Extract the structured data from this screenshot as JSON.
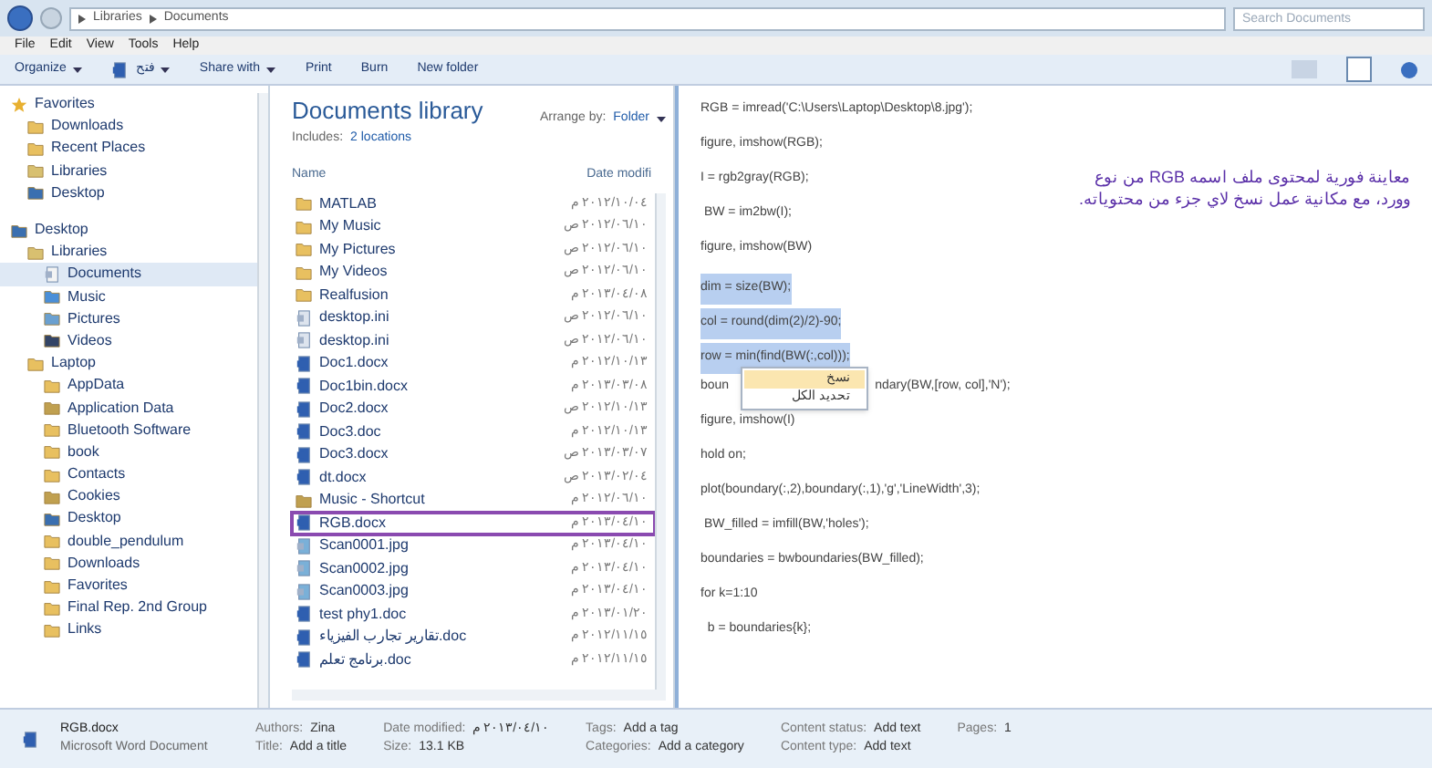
{
  "address_bar": {
    "crumbs": [
      "Libraries",
      "Documents"
    ],
    "search_placeholder": "Search Documents"
  },
  "menu_bar": [
    "File",
    "Edit",
    "View",
    "Tools",
    "Help"
  ],
  "toolbar": [
    {
      "label": "Organize",
      "dropdown": true
    },
    {
      "label": "فتح",
      "dropdown": true,
      "kind": "open"
    },
    {
      "label": "Share with",
      "dropdown": true
    },
    {
      "label": "Print",
      "dropdown": false
    },
    {
      "label": "Burn",
      "dropdown": false
    },
    {
      "label": "New folder",
      "dropdown": false
    }
  ],
  "nav_tree": [
    {
      "label": "Favorites",
      "kind": "star",
      "selected": false,
      "children": [
        {
          "label": "Downloads",
          "kind": "folder",
          "selected": false
        },
        {
          "label": "Recent Places",
          "kind": "folder",
          "selected": false
        },
        {
          "label": "Libraries",
          "kind": "library",
          "selected": false
        },
        {
          "label": "Desktop",
          "kind": "desktop",
          "selected": false
        }
      ]
    },
    {
      "label": "Desktop",
      "kind": "desktop",
      "selected": false,
      "children": [
        {
          "label": "Libraries",
          "kind": "library",
          "selected": false,
          "children": [
            {
              "label": "Documents",
              "kind": "document",
              "selected": true
            },
            {
              "label": "Music",
              "kind": "music",
              "selected": false
            },
            {
              "label": "Pictures",
              "kind": "picture",
              "selected": false
            },
            {
              "label": "Videos",
              "kind": "video",
              "selected": false
            }
          ]
        },
        {
          "label": "Laptop",
          "kind": "folder",
          "selected": false,
          "children": [
            {
              "label": "AppData",
              "kind": "folder",
              "selected": false
            },
            {
              "label": "Application Data",
              "kind": "shortcut",
              "selected": false
            },
            {
              "label": "Bluetooth Software",
              "kind": "folder",
              "selected": false
            },
            {
              "label": "book",
              "kind": "folder",
              "selected": false
            },
            {
              "label": "Contacts",
              "kind": "folder",
              "selected": false
            },
            {
              "label": "Cookies",
              "kind": "shortcut",
              "selected": false
            },
            {
              "label": "Desktop",
              "kind": "desktop",
              "selected": false
            },
            {
              "label": "double_pendulum",
              "kind": "folder",
              "selected": false
            },
            {
              "label": "Downloads",
              "kind": "folder",
              "selected": false
            },
            {
              "label": "Favorites",
              "kind": "folder",
              "selected": false
            },
            {
              "label": "Final Rep. 2nd Group",
              "kind": "folder",
              "selected": false
            },
            {
              "label": "Links",
              "kind": "folder",
              "selected": false
            }
          ]
        }
      ]
    }
  ],
  "library": {
    "title": "Documents library",
    "includes_label": "Includes:",
    "includes_link": "2 locations",
    "arrange_label": "Arrange by:",
    "arrange_value": "Folder"
  },
  "file_list": {
    "columns": [
      "Name",
      "Date modifi"
    ],
    "rows": [
      {
        "name": "MATLAB",
        "date": "٢٠١٢/١٠/٠٤ م",
        "kind": "folder",
        "selected": false
      },
      {
        "name": "My Music",
        "date": "٢٠١٢/٠٦/١٠ ص",
        "kind": "folder",
        "selected": false
      },
      {
        "name": "My Pictures",
        "date": "٢٠١٢/٠٦/١٠ ص",
        "kind": "folder",
        "selected": false
      },
      {
        "name": "My Videos",
        "date": "٢٠١٢/٠٦/١٠ ص",
        "kind": "folder",
        "selected": false
      },
      {
        "name": "Realfusion",
        "date": "٢٠١٣/٠٤/٠٨ م",
        "kind": "folder",
        "selected": false
      },
      {
        "name": "desktop.ini",
        "date": "٢٠١٢/٠٦/١٠ ص",
        "kind": "ini",
        "selected": false
      },
      {
        "name": "desktop.ini",
        "date": "٢٠١٢/٠٦/١٠ ص",
        "kind": "ini",
        "selected": false
      },
      {
        "name": "Doc1.docx",
        "date": "٢٠١٢/١٠/١٣ م",
        "kind": "doc",
        "selected": false
      },
      {
        "name": "Doc1bin.docx",
        "date": "٢٠١٣/٠٣/٠٨ م",
        "kind": "doc",
        "selected": false
      },
      {
        "name": "Doc2.docx",
        "date": "٢٠١٢/١٠/١٣ ص",
        "kind": "doc",
        "selected": false
      },
      {
        "name": "Doc3.doc",
        "date": "٢٠١٢/١٠/١٣ م",
        "kind": "doc",
        "selected": false
      },
      {
        "name": "Doc3.docx",
        "date": "٢٠١٣/٠٣/٠٧ ص",
        "kind": "doc",
        "selected": false
      },
      {
        "name": "dt.docx",
        "date": "٢٠١٣/٠٢/٠٤ ص",
        "kind": "doc",
        "selected": false
      },
      {
        "name": "Music - Shortcut",
        "date": "٢٠١٢/٠٦/١٠ م",
        "kind": "shortcut",
        "selected": false
      },
      {
        "name": "RGB.docx",
        "date": "٢٠١٣/٠٤/١٠ م",
        "kind": "doc",
        "selected": true
      },
      {
        "name": "Scan0001.jpg",
        "date": "٢٠١٣/٠٤/١٠ م",
        "kind": "image",
        "selected": false
      },
      {
        "name": "Scan0002.jpg",
        "date": "٢٠١٣/٠٤/١٠ م",
        "kind": "image",
        "selected": false
      },
      {
        "name": "Scan0003.jpg",
        "date": "٢٠١٣/٠٤/١٠ م",
        "kind": "image",
        "selected": false
      },
      {
        "name": "test phy1.doc",
        "date": "٢٠١٣/٠١/٢٠ م",
        "kind": "doc",
        "selected": false
      },
      {
        "name": "تقارير تجارب الفيزياء.doc",
        "date": "٢٠١٢/١١/١٥ م",
        "kind": "doc",
        "selected": false
      },
      {
        "name": "برنامج تعلم.doc",
        "date": "٢٠١٢/١١/١٥ م",
        "kind": "doc",
        "selected": false
      }
    ]
  },
  "preview": {
    "lines": [
      {
        "text": "RGB = imread('C:\\Users\\Laptop\\Desktop\\8.jpg');",
        "selected": false
      },
      {
        "text": "figure, imshow(RGB);",
        "selected": false
      },
      {
        "text": "I = rgb2gray(RGB);",
        "selected": false
      },
      {
        "text": " BW = im2bw(I);",
        "selected": false
      },
      {
        "text": "figure, imshow(BW)",
        "selected": false
      },
      {
        "text": "dim = size(BW);",
        "selected": true
      },
      {
        "text": "col = round(dim(2)/2)-90;",
        "selected": true
      },
      {
        "text": "row = min(find(BW(:,col)));",
        "selected": true
      },
      {
        "text": "boun",
        "text_after": "ndary(BW,[row, col],'N');",
        "selected": false
      },
      {
        "text": "figure, imshow(I)",
        "selected": false
      },
      {
        "text": "hold on;",
        "selected": false
      },
      {
        "text": "plot(boundary(:,2),boundary(:,1),'g','LineWidth',3);",
        "selected": false
      },
      {
        "text": " BW_filled = imfill(BW,'holes');",
        "selected": false
      },
      {
        "text": "boundaries = bwboundaries(BW_filled);",
        "selected": false
      },
      {
        "text": "for k=1:10",
        "selected": false
      },
      {
        "text": "  b = boundaries{k};",
        "selected": false
      }
    ],
    "context_menu": [
      {
        "label": "نسخ",
        "highlighted": true
      },
      {
        "label": "تحديد الكل",
        "highlighted": false
      }
    ],
    "annotation": "معاينة فورية لمحتوى ملف اسمه RGB من نوع وورد، مع مكانية عمل نسخ لاي جزء من محتوياته."
  },
  "details": {
    "name": "RGB.docx",
    "type": "Microsoft Word Document",
    "fields": [
      {
        "label": "Authors:",
        "value": "Zina"
      },
      {
        "label": "Title:",
        "value": "Add a title"
      },
      {
        "label": "Date modified:",
        "value": "٢٠١٣/٠٤/١٠ م"
      },
      {
        "label": "Size:",
        "value": "13.1 KB"
      },
      {
        "label": "Tags:",
        "value": "Add a tag"
      },
      {
        "label": "Categories:",
        "value": "Add a category"
      },
      {
        "label": "Content status:",
        "value": "Add text"
      },
      {
        "label": "Content type:",
        "value": "Add text"
      },
      {
        "label": "Pages:",
        "value": "1"
      }
    ]
  }
}
